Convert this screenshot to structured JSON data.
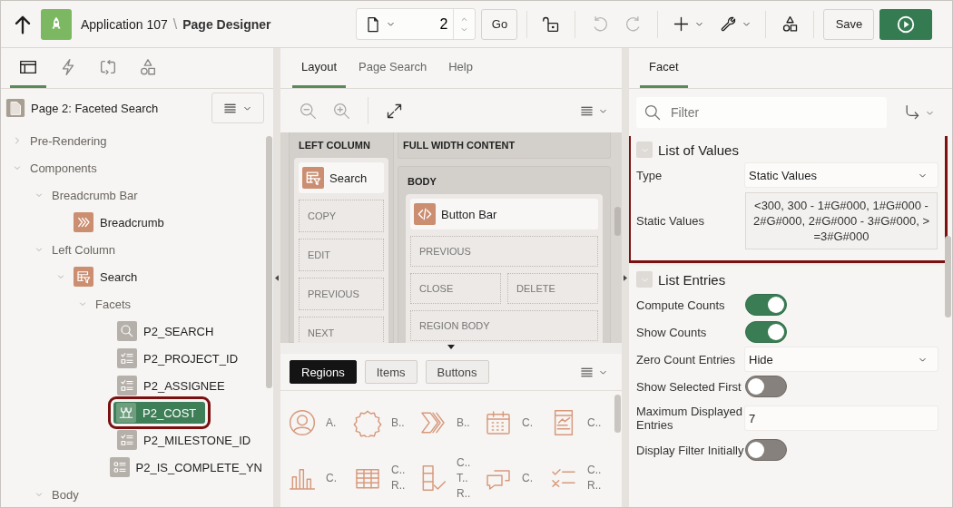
{
  "toolbar": {
    "app_name": "Application 107",
    "separator": "\\",
    "title": "Page Designer",
    "page_number": "2",
    "go_button": "Go",
    "save_button": "Save"
  },
  "left_tabs": [
    {
      "kind": "layout",
      "selected": true
    },
    {
      "kind": "bolt",
      "selected": false
    },
    {
      "kind": "cycle",
      "selected": false
    },
    {
      "kind": "shapes",
      "selected": false
    }
  ],
  "page_header": {
    "title": "Page 2: Faceted Search"
  },
  "tree": [
    {
      "label": "Pre-Rendering",
      "expanded": false,
      "selected": false,
      "highlighted": false
    },
    {
      "label": "Components",
      "expanded": true,
      "selected": false,
      "highlighted": false,
      "children": [
        {
          "label": "Breadcrumb Bar",
          "expanded": true,
          "selected": false,
          "highlighted": false,
          "children": [
            {
              "label": "Breadcrumb",
              "kind": "breadcrumb",
              "selected": false,
              "highlighted": false
            }
          ]
        },
        {
          "label": "Left Column",
          "expanded": true,
          "selected": false,
          "highlighted": false,
          "children": [
            {
              "label": "Search",
              "kind": "faceted-search",
              "expanded": true,
              "selected": false,
              "highlighted": false,
              "children": [
                {
                  "label": "Facets",
                  "expanded": true,
                  "selected": false,
                  "highlighted": false,
                  "children": [
                    {
                      "label": "P2_SEARCH",
                      "kind": "magnifier",
                      "selected": false,
                      "highlighted": false
                    },
                    {
                      "label": "P2_PROJECT_ID",
                      "kind": "checklist",
                      "selected": false,
                      "highlighted": false
                    },
                    {
                      "label": "P2_ASSIGNEE",
                      "kind": "checklist",
                      "selected": false,
                      "highlighted": false
                    },
                    {
                      "label": "P2_COST",
                      "kind": "range",
                      "selected": true,
                      "highlighted": true
                    },
                    {
                      "label": "P2_MILESTONE_ID",
                      "kind": "checklist",
                      "selected": false,
                      "highlighted": false
                    },
                    {
                      "label": "P2_IS_COMPLETE_YN",
                      "kind": "radio-list",
                      "selected": false,
                      "highlighted": false
                    }
                  ]
                }
              ]
            }
          ]
        },
        {
          "label": "Body",
          "expanded": true,
          "selected": false,
          "highlighted": false
        }
      ]
    }
  ],
  "middle_tabs": [
    {
      "label": "Layout",
      "selected": true
    },
    {
      "label": "Page Search",
      "selected": false
    },
    {
      "label": "Help",
      "selected": false
    }
  ],
  "layout": {
    "left_column": {
      "title": "LEFT COLUMN",
      "region": {
        "title": "Search",
        "kind": "faceted-search"
      },
      "slots": [
        [
          "COPY"
        ],
        [
          "EDIT"
        ],
        [
          "PREVIOUS"
        ],
        [
          "NEXT"
        ]
      ]
    },
    "full_width": {
      "title": "FULL WIDTH CONTENT"
    },
    "body": {
      "title": "BODY",
      "region": {
        "title": "Button Bar",
        "kind": "code"
      },
      "slots": [
        [
          "PREVIOUS"
        ],
        [
          "CLOSE",
          "DELETE"
        ],
        [
          "REGION BODY"
        ]
      ]
    }
  },
  "gallery_tabs": [
    {
      "label": "Regions",
      "selected": true
    },
    {
      "label": "Items",
      "selected": false
    },
    {
      "label": "Buttons",
      "selected": false
    }
  ],
  "gallery": [
    {
      "kind": "avatar",
      "label": "A."
    },
    {
      "kind": "badge",
      "label": "B.."
    },
    {
      "kind": "chevrons",
      "label": "B.."
    },
    {
      "kind": "calendar",
      "label": "C."
    },
    {
      "kind": "card",
      "label": "C.."
    },
    {
      "kind": "bar-chart",
      "label": "C."
    },
    {
      "kind": "grid",
      "label": "C..\nR.."
    },
    {
      "kind": "tall-list",
      "label": "C..\nT..\nR.."
    },
    {
      "kind": "comments",
      "label": "C."
    },
    {
      "kind": "check-cross",
      "label": "C..\nR.."
    }
  ],
  "right_tabs": [
    {
      "label": "Facet",
      "selected": true
    }
  ],
  "filter": {
    "placeholder": "Filter"
  },
  "sections": [
    {
      "title": "List of Values",
      "expanded": true,
      "highlighted": true,
      "properties": [
        {
          "kind": "select",
          "label": "Type",
          "value": "Static Values"
        },
        {
          "kind": "textarea",
          "label": "Static Values",
          "value": "<300, 300 - 1#G#000, 1#G#000 - 2#G#000, 2#G#000 - 3#G#000, >=3#G#000"
        }
      ]
    },
    {
      "title": "List Entries",
      "expanded": true,
      "properties": [
        {
          "kind": "switch",
          "label": "Compute Counts",
          "on": true
        },
        {
          "kind": "switch",
          "label": "Show Counts",
          "on": true
        },
        {
          "kind": "select",
          "label": "Zero Count Entries",
          "value": "Hide"
        },
        {
          "kind": "switch",
          "label": "Show Selected First",
          "on": false
        },
        {
          "kind": "text",
          "label": "Maximum Displayed Entries",
          "value": "7"
        },
        {
          "kind": "switch",
          "label": "Display Filter Initially",
          "on": false
        }
      ]
    }
  ]
}
